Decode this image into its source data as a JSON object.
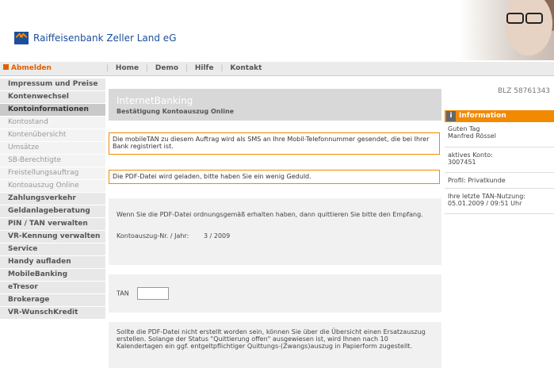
{
  "header": {
    "bank_name": "Raiffeisenbank Zeller Land eG"
  },
  "nav": {
    "logout": "Abmelden",
    "items": [
      "Home",
      "Demo",
      "Hilfe",
      "Kontakt"
    ]
  },
  "sidebar": {
    "items": [
      {
        "label": "Impressum und Preise",
        "type": "main"
      },
      {
        "label": "Kontenwechsel",
        "type": "main"
      },
      {
        "label": "Kontoinformationen",
        "type": "active"
      },
      {
        "label": "Kontostand",
        "type": "sub"
      },
      {
        "label": "Kontenübersicht",
        "type": "sub"
      },
      {
        "label": "Umsätze",
        "type": "sub"
      },
      {
        "label": "SB-Berechtigte",
        "type": "sub"
      },
      {
        "label": "Freistellungsauftrag",
        "type": "sub"
      },
      {
        "label": "Kontoauszug Online",
        "type": "sub"
      },
      {
        "label": "Zahlungsverkehr",
        "type": "main"
      },
      {
        "label": "Geldanlageberatung",
        "type": "main"
      },
      {
        "label": "PIN / TAN verwalten",
        "type": "main"
      },
      {
        "label": "VR-Kennung verwalten",
        "type": "main"
      },
      {
        "label": "Service",
        "type": "main"
      },
      {
        "label": "Handy aufladen",
        "type": "main"
      },
      {
        "label": "MobileBanking",
        "type": "main"
      },
      {
        "label": "eTresor",
        "type": "main"
      },
      {
        "label": "Brokerage",
        "type": "main"
      },
      {
        "label": "VR-WunschKredit",
        "type": "main"
      }
    ]
  },
  "blz": "BLZ 58761343",
  "banner": {
    "title": "InternetBanking",
    "subtitle": "Bestätigung Kontoauszug Online"
  },
  "messages": {
    "mobile_tan": "Die mobileTAN zu diesem Auftrag wird als SMS an Ihre Mobil-Telefonnummer gesendet, die bei Ihrer Bank registriert ist.",
    "pdf_loading": "Die PDF-Datei wird geladen, bitte haben Sie ein wenig Geduld."
  },
  "panel_confirm": {
    "text": "Wenn Sie die PDF-Datei ordnungsgemäß erhalten haben, dann quittieren Sie bitte den Empfang.",
    "label": "Kontoauszug-Nr. / Jahr:",
    "value": "3 / 2009"
  },
  "panel_tan": {
    "label": "TAN"
  },
  "panel_note": {
    "text": "Sollte die PDF-Datei nicht erstellt worden sein, können Sie über die Übersicht einen Ersatzauszug erstellen. Solange der Status \"Quittierung offen\" ausgewiesen ist, wird Ihnen nach 10 Kalendertagen ein ggf. entgeltpflichtiger Quittungs-(Zwangs)auszug in Papierform zugestellt."
  },
  "info": {
    "title": "Information",
    "greeting": "Guten Tag",
    "user": "Manfred Rössel",
    "account_label": "aktives Konto:",
    "account_number": "3007451",
    "profile": "Profil: Privatkunde",
    "tan_label": "Ihre letzte TAN-Nutzung:",
    "tan_time": "05.01.2009 / 09:51 Uhr"
  }
}
